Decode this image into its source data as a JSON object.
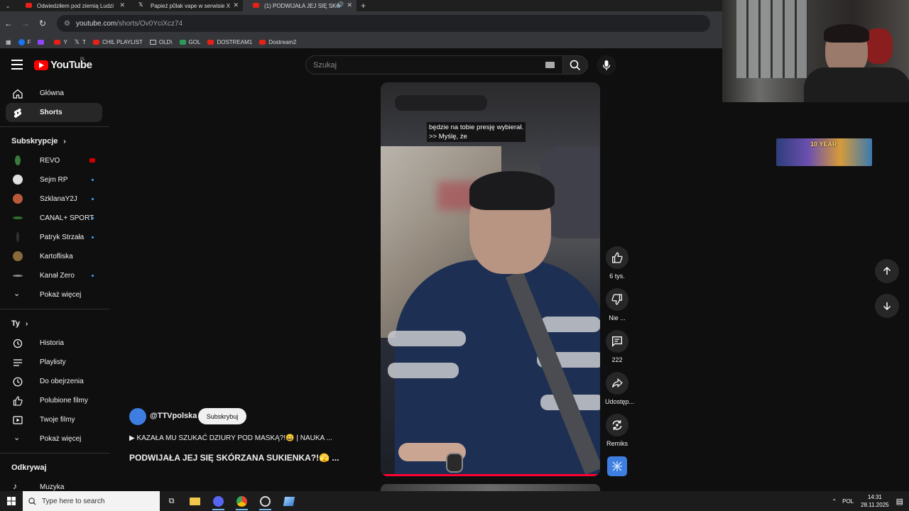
{
  "browser": {
    "tabs": [
      {
        "title": "Odwiedziłem pod ziemią Ludzi",
        "icon": "youtube-favicon",
        "active": false
      },
      {
        "title": "Papież p0lak vape w serwisie X",
        "icon": "x-favicon",
        "active": false
      },
      {
        "title": "(1) PODWIJAŁA JEJ SIĘ SKÓ",
        "icon": "youtube-favicon",
        "active": true
      }
    ],
    "url_host": "youtube.com",
    "url_path": "/shorts/Ov0YciXcz74",
    "bookmarks": [
      {
        "label": "F",
        "icon": "facebook-icon"
      },
      {
        "label": "",
        "icon": "twitch-icon"
      },
      {
        "label": "Y",
        "icon": "youtube-icon"
      },
      {
        "label": "T",
        "icon": "x-icon"
      },
      {
        "label": "CHIL PLAYLIST",
        "icon": "youtube-icon"
      },
      {
        "label": "OLD\\",
        "icon": "folder-icon"
      },
      {
        "label": "GOL",
        "icon": "gol-icon"
      },
      {
        "label": "DOSTREAM1",
        "icon": "youtube-icon"
      },
      {
        "label": "Dostream2",
        "icon": "youtube-icon"
      }
    ]
  },
  "youtube": {
    "logo_text": "YouTube",
    "country_code": "PL",
    "search_placeholder": "Szukaj",
    "sidebar": {
      "main": [
        {
          "label": "Główna",
          "icon": "home-icon"
        },
        {
          "label": "Shorts",
          "icon": "shorts-icon"
        }
      ],
      "subs_heading": "Subskrypcje",
      "subscriptions": [
        {
          "label": "REVO",
          "color": "#3b7a3b",
          "badge": "live"
        },
        {
          "label": "Sejm RP",
          "color": "#e0e0e0",
          "badge": "dot"
        },
        {
          "label": "SzklanaY2J",
          "color": "#b85a3a",
          "badge": "dot"
        },
        {
          "label": "CANAL+ SPORT",
          "color": "#2d6e2d",
          "badge": "dot"
        },
        {
          "label": "Patryk Strzała",
          "color": "#333333",
          "badge": "dot"
        },
        {
          "label": "Kartofliska",
          "color": "#8a6a3a",
          "badge": "none"
        },
        {
          "label": "Kanał Zero",
          "color": "#888888",
          "badge": "dot"
        }
      ],
      "subs_more": "Pokaż więcej",
      "you_heading": "Ty",
      "you_items": [
        {
          "label": "Historia",
          "icon": "history-icon"
        },
        {
          "label": "Playlisty",
          "icon": "playlist-icon"
        },
        {
          "label": "Do obejrzenia",
          "icon": "clock-icon"
        },
        {
          "label": "Polubione filmy",
          "icon": "like-icon"
        },
        {
          "label": "Twoje filmy",
          "icon": "video-icon"
        }
      ],
      "you_more": "Pokaż więcej",
      "explore_heading": "Odkrywaj",
      "explore_items": [
        {
          "label": "Muzyka",
          "icon": "music-icon"
        }
      ]
    },
    "short": {
      "captions_line1": "będzie na tobie presję wybierał.",
      "captions_line2": ">> Myślę, że",
      "progress": 0.99,
      "channel": "@TTVpolska",
      "subscribe_label": "Subskrybuj",
      "description": "▶ KAZAŁA MU SZUKAĆ DZIURY POD MASKĄ?!😄 | NAUKA ...",
      "title": "PODWIJAŁA JEJ SIĘ SKÓRZANA SUKIENKA?!🫣 ..."
    },
    "actions": [
      {
        "label": "6 tys.",
        "icon": "thumbs-up-icon"
      },
      {
        "label": "Nie ...",
        "icon": "thumbs-down-icon"
      },
      {
        "label": "222",
        "icon": "comment-icon"
      },
      {
        "label": "Udostęp...",
        "icon": "share-icon"
      },
      {
        "label": "Remiks",
        "icon": "remix-icon"
      }
    ],
    "banner_text": "10 YEAR"
  },
  "taskbar": {
    "search_placeholder": "Type here to search",
    "language": "POL",
    "time": "14:31",
    "date": "28.11.2025"
  }
}
